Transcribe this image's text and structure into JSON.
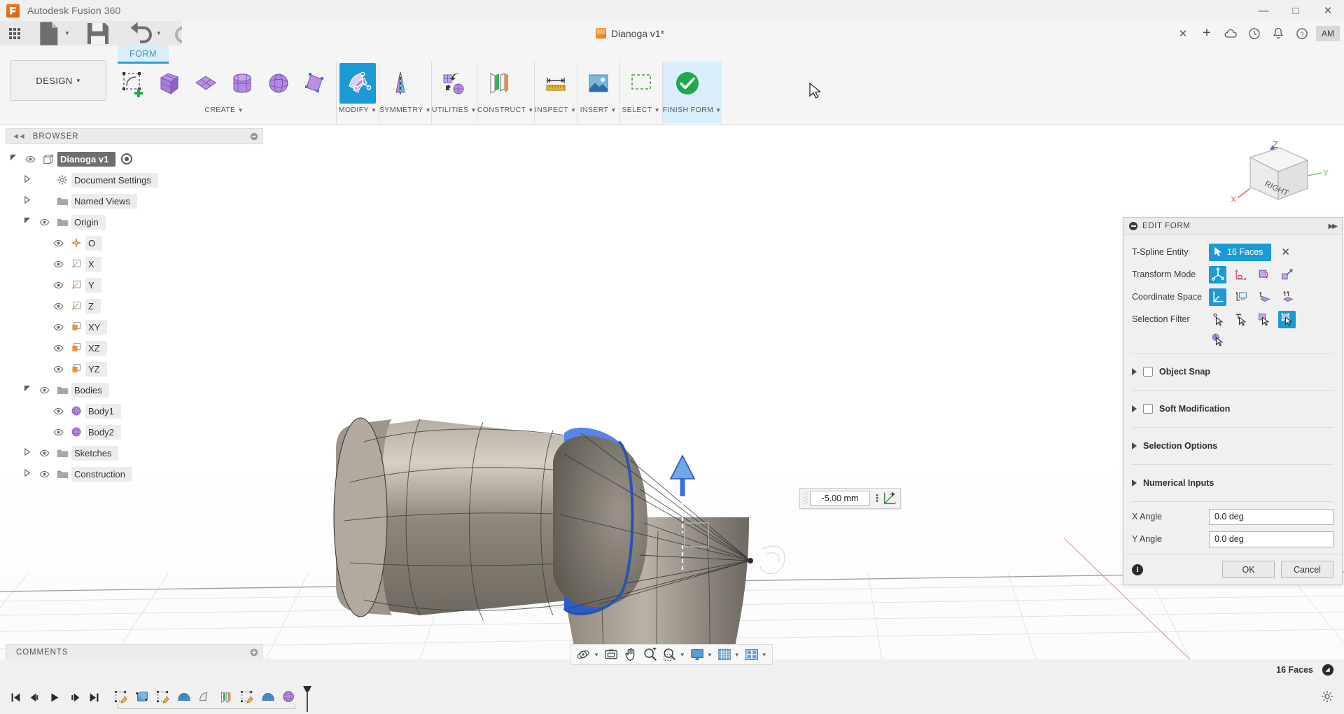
{
  "titlebar": {
    "app_name": "Autodesk Fusion 360",
    "logo_icon": "fusion-logo-icon",
    "minimize": "—",
    "maximize": "□",
    "close": "✕"
  },
  "quick_access": {
    "items": [
      {
        "name": "app-grid",
        "icon": "grid-icon",
        "caret": false
      },
      {
        "name": "new-document",
        "icon": "file-icon",
        "caret": true
      },
      {
        "name": "save",
        "icon": "save-icon",
        "caret": false
      },
      {
        "name": "undo",
        "icon": "undo-arrow-icon",
        "caret": true
      },
      {
        "name": "redo",
        "icon": "redo-arrow-icon",
        "caret": true
      }
    ]
  },
  "document_tab": {
    "title": "Dianoga v1*",
    "icon": "cube-icon",
    "close": "✕"
  },
  "tabstrip_right": {
    "add": "+",
    "help_label": "?",
    "avatar": "AM",
    "icons": [
      "plus-icon",
      "cloud-icon",
      "clock-icon",
      "bell-icon",
      "help-icon"
    ]
  },
  "workspace": {
    "label": "DESIGN",
    "caret": "▾"
  },
  "ribbon": {
    "active_tab": "FORM",
    "panels": [
      {
        "label": "CREATE",
        "has_caret": true,
        "tools": [
          {
            "name": "create-form-tool",
            "icon": "create-sketch-plus-icon",
            "state": "normal"
          },
          {
            "name": "box-tool",
            "icon": "tspline-box-icon",
            "state": "normal"
          },
          {
            "name": "plane-tool",
            "icon": "tspline-plane-icon",
            "state": "normal"
          },
          {
            "name": "cylinder-tool",
            "icon": "tspline-cylinder-icon",
            "state": "normal"
          },
          {
            "name": "sphere-tool",
            "icon": "tspline-sphere-icon",
            "state": "normal"
          },
          {
            "name": "face-tool",
            "icon": "tspline-face-icon",
            "state": "normal"
          }
        ]
      },
      {
        "label": "MODIFY",
        "has_caret": true,
        "tools": [
          {
            "name": "edit-form-tool",
            "icon": "edit-form-icon",
            "state": "active"
          }
        ]
      },
      {
        "label": "SYMMETRY",
        "has_caret": true,
        "tools": [
          {
            "name": "mirror-internal-tool",
            "icon": "symmetry-mirror-icon",
            "state": "normal"
          }
        ]
      },
      {
        "label": "UTILITIES",
        "has_caret": true,
        "tools": [
          {
            "name": "convert-tool",
            "icon": "convert-icon",
            "state": "normal"
          }
        ]
      },
      {
        "label": "CONSTRUCT",
        "has_caret": true,
        "tools": [
          {
            "name": "offset-plane-tool",
            "icon": "construct-plane-icon",
            "state": "normal"
          }
        ]
      },
      {
        "label": "INSPECT",
        "has_caret": true,
        "tools": [
          {
            "name": "measure-tool",
            "icon": "ruler-icon",
            "state": "normal"
          }
        ]
      },
      {
        "label": "INSERT",
        "has_caret": true,
        "tools": [
          {
            "name": "insert-canvas-tool",
            "icon": "image-icon",
            "state": "normal"
          }
        ]
      },
      {
        "label": "SELECT",
        "has_caret": true,
        "tools": [
          {
            "name": "select-tool",
            "icon": "selection-window-icon",
            "state": "normal"
          }
        ]
      },
      {
        "label": "FINISH FORM",
        "has_caret": true,
        "tools": [
          {
            "name": "finish-form-tool",
            "icon": "green-check-icon",
            "state": "selfinish"
          }
        ]
      }
    ]
  },
  "browser": {
    "title": "BROWSER",
    "collapse_icon": "collapse-left-icon",
    "nodes": [
      {
        "label": "Dianoga v1",
        "depth": 0,
        "twisty": "expanded",
        "eye": true,
        "icon": "document-icon",
        "root": true,
        "radio": true
      },
      {
        "label": "Document Settings",
        "depth": 1,
        "twisty": "collapsed",
        "eye": false,
        "icon": "gear-icon"
      },
      {
        "label": "Named Views",
        "depth": 1,
        "twisty": "collapsed",
        "eye": false,
        "icon": "folder-icon"
      },
      {
        "label": "Origin",
        "depth": 1,
        "twisty": "expanded",
        "eye": true,
        "icon": "folder-icon"
      },
      {
        "label": "O",
        "depth": 2,
        "twisty": "none",
        "eye": true,
        "icon": "origin-point-icon"
      },
      {
        "label": "X",
        "depth": 2,
        "twisty": "none",
        "eye": true,
        "icon": "axis-icon"
      },
      {
        "label": "Y",
        "depth": 2,
        "twisty": "none",
        "eye": true,
        "icon": "axis-icon"
      },
      {
        "label": "Z",
        "depth": 2,
        "twisty": "none",
        "eye": true,
        "icon": "axis-icon"
      },
      {
        "label": "XY",
        "depth": 2,
        "twisty": "none",
        "eye": true,
        "icon": "plane-icon"
      },
      {
        "label": "XZ",
        "depth": 2,
        "twisty": "none",
        "eye": true,
        "icon": "plane-icon"
      },
      {
        "label": "YZ",
        "depth": 2,
        "twisty": "none",
        "eye": true,
        "icon": "plane-icon"
      },
      {
        "label": "Bodies",
        "depth": 1,
        "twisty": "expanded",
        "eye": true,
        "icon": "folder-icon"
      },
      {
        "label": "Body1",
        "depth": 2,
        "twisty": "none",
        "eye": true,
        "icon": "tspline-body-icon"
      },
      {
        "label": "Body2",
        "depth": 2,
        "twisty": "none",
        "eye": true,
        "icon": "tspline-body-icon"
      },
      {
        "label": "Sketches",
        "depth": 1,
        "twisty": "collapsed",
        "eye": true,
        "icon": "folder-icon"
      },
      {
        "label": "Construction",
        "depth": 1,
        "twisty": "collapsed",
        "eye": true,
        "icon": "folder-icon"
      }
    ]
  },
  "comments": {
    "title": "COMMENTS"
  },
  "viewcube": {
    "face_label": "RIGHT",
    "axis_z": "Z",
    "axis_y": "Y",
    "axis_x": "X"
  },
  "edit_form": {
    "title": "EDIT FORM",
    "expand_icon": "expand-right-icon",
    "rows": [
      {
        "label": "T-Spline Entity",
        "type": "selection",
        "value": "16 Faces",
        "clear": "✕"
      },
      {
        "label": "Transform Mode",
        "type": "buttons",
        "buttons": [
          {
            "name": "transform-mode-free",
            "icon": "free-move-icon",
            "on": true
          },
          {
            "name": "transform-mode-translate",
            "icon": "translate-icon",
            "on": false
          },
          {
            "name": "transform-mode-rotate",
            "icon": "rotate-icon",
            "on": false
          },
          {
            "name": "transform-mode-scale",
            "icon": "scale-icon",
            "on": false
          }
        ]
      },
      {
        "label": "Coordinate Space",
        "type": "buttons",
        "buttons": [
          {
            "name": "coordinate-space-world",
            "icon": "world-axes-icon",
            "on": true
          },
          {
            "name": "coordinate-space-view",
            "icon": "view-space-icon",
            "on": false
          },
          {
            "name": "coordinate-space-normal",
            "icon": "normal-space-icon",
            "on": false
          },
          {
            "name": "coordinate-space-local",
            "icon": "local-space-icon",
            "on": false
          }
        ]
      },
      {
        "label": "Selection Filter",
        "type": "buttons",
        "buttons": [
          {
            "name": "selection-filter-vertex",
            "icon": "vertex-cursor-icon",
            "on": false
          },
          {
            "name": "selection-filter-edge",
            "icon": "edge-cursor-icon",
            "on": false
          },
          {
            "name": "selection-filter-face",
            "icon": "face-cursor-icon",
            "on": false
          },
          {
            "name": "selection-filter-box",
            "icon": "box-cursor-icon",
            "on": true
          }
        ]
      },
      {
        "label": "",
        "type": "buttons",
        "buttons": [
          {
            "name": "selection-filter-body",
            "icon": "body-cursor-icon",
            "on": false
          }
        ]
      }
    ],
    "accordions": [
      {
        "label": "Object Snap",
        "checkbox": true,
        "expanded": false
      },
      {
        "label": "Soft Modification",
        "checkbox": true,
        "expanded": false
      },
      {
        "label": "Selection Options",
        "checkbox": false,
        "expanded": false
      },
      {
        "label": "Numerical Inputs",
        "checkbox": false,
        "expanded": false
      }
    ],
    "fields": [
      {
        "label": "X Angle",
        "value": "0.0 deg"
      },
      {
        "label": "Y Angle",
        "value": "0.0 deg"
      }
    ],
    "info_icon": "info-icon",
    "ok_label": "OK",
    "cancel_label": "Cancel"
  },
  "value_input": {
    "value": "-5.00 mm",
    "grip_icon": "drag-grip-icon",
    "menu_icon": "vertical-dots-icon",
    "axis_icon": "manipulator-axis-icon"
  },
  "navbar": {
    "items": [
      {
        "name": "orbit-tool",
        "icon": "orbit-icon",
        "caret": true
      },
      {
        "name": "look-at-tool",
        "icon": "look-at-icon",
        "caret": false
      },
      {
        "name": "pan-tool",
        "icon": "hand-pan-icon",
        "caret": false
      },
      {
        "name": "zoom-tool",
        "icon": "zoom-magnifier-icon",
        "caret": false
      },
      {
        "name": "fit-tool",
        "icon": "zoom-fit-icon",
        "caret": true
      },
      {
        "name": "display-settings",
        "icon": "monitor-display-icon",
        "caret": true
      },
      {
        "name": "grid-snaps",
        "icon": "grid-snap-icon",
        "caret": true
      },
      {
        "name": "viewports",
        "icon": "viewports-icon",
        "caret": true
      }
    ]
  },
  "statusbar": {
    "selection_count": "16 Faces",
    "resize_icon": "resize-grip-icon"
  },
  "timeline": {
    "playback": [
      {
        "name": "timeline-go-start",
        "icon": "skip-start-icon"
      },
      {
        "name": "timeline-step-back",
        "icon": "step-back-icon"
      },
      {
        "name": "timeline-play",
        "icon": "play-icon"
      },
      {
        "name": "timeline-step-forward",
        "icon": "step-forward-icon"
      },
      {
        "name": "timeline-go-end",
        "icon": "skip-end-icon"
      }
    ],
    "features": [
      {
        "name": "timeline-feature-sketch-1",
        "icon": "sketch-icon"
      },
      {
        "name": "timeline-feature-extrude",
        "icon": "extrude-icon"
      },
      {
        "name": "timeline-feature-sketch-2",
        "icon": "sketch-icon"
      },
      {
        "name": "timeline-feature-form-1",
        "icon": "form-icon"
      },
      {
        "name": "timeline-feature-patch",
        "icon": "patch-icon"
      },
      {
        "name": "timeline-feature-plane",
        "icon": "construct-plane-icon"
      },
      {
        "name": "timeline-feature-sketch-3",
        "icon": "sketch-icon"
      },
      {
        "name": "timeline-feature-form-2",
        "icon": "form-icon"
      },
      {
        "name": "timeline-feature-tspline",
        "icon": "tspline-body-icon"
      }
    ],
    "marker_icon": "timeline-marker-icon",
    "settings_icon": "gear-icon"
  },
  "colors": {
    "accent_blue": "#1b9ad6",
    "tab_blue": "#2f9fd6",
    "selection_blue": "#3a6fd8",
    "model_tan": "#8b8274",
    "orange": "#e8731a"
  }
}
